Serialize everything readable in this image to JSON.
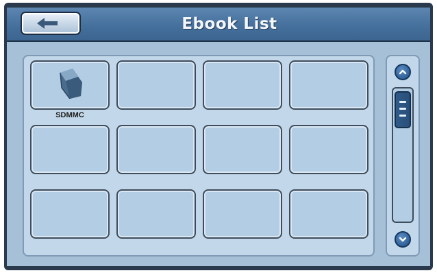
{
  "header": {
    "title": "Ebook List",
    "back_icon": "arrow-left-icon"
  },
  "grid": {
    "columns": 4,
    "rows": 3,
    "items": [
      {
        "label": "SDMMC",
        "icon": "folder-icon"
      },
      {
        "label": "",
        "icon": ""
      },
      {
        "label": "",
        "icon": ""
      },
      {
        "label": "",
        "icon": ""
      },
      {
        "label": "",
        "icon": ""
      },
      {
        "label": "",
        "icon": ""
      },
      {
        "label": "",
        "icon": ""
      },
      {
        "label": "",
        "icon": ""
      },
      {
        "label": "",
        "icon": ""
      },
      {
        "label": "",
        "icon": ""
      },
      {
        "label": "",
        "icon": ""
      },
      {
        "label": "",
        "icon": ""
      }
    ]
  },
  "scrollbar": {
    "up_icon": "chevron-up-icon",
    "down_icon": "chevron-down-icon",
    "thumb_icon": "grip-lines-icon",
    "position": 0
  },
  "colors": {
    "titlebar": "#4a76a6",
    "content_bg": "#a6c0d7",
    "cell_bg": "#b2cde4",
    "accent": "#1e4f86"
  }
}
